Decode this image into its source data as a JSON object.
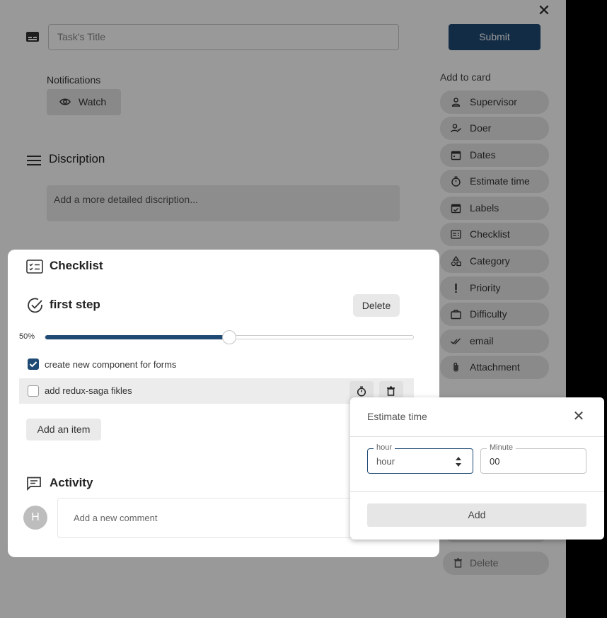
{
  "header": {
    "title_placeholder": "Task's Title",
    "submit_label": "Submit"
  },
  "notifications": {
    "label": "Notifications",
    "watch_label": "Watch"
  },
  "description": {
    "title": "Discription",
    "placeholder": "Add a more detailed discription..."
  },
  "sidebar": {
    "label": "Add to card",
    "items": [
      {
        "label": "Supervisor",
        "icon": "person-icon"
      },
      {
        "label": "Doer",
        "icon": "person-check-icon"
      },
      {
        "label": "Dates",
        "icon": "calendar-icon"
      },
      {
        "label": "Estimate time",
        "icon": "timer-icon"
      },
      {
        "label": "Labels",
        "icon": "calendar-check-icon"
      },
      {
        "label": "Checklist",
        "icon": "checklist-icon"
      },
      {
        "label": "Category",
        "icon": "category-icon"
      },
      {
        "label": "Priority",
        "icon": "exclamation-icon"
      },
      {
        "label": "Difficulty",
        "icon": "briefcase-icon"
      },
      {
        "label": "email",
        "icon": "double-check-icon"
      },
      {
        "label": "Attachment",
        "icon": "paperclip-icon"
      }
    ],
    "delete_label": "Delete"
  },
  "checklist": {
    "title": "Checklist",
    "step_title": "first step",
    "delete_label": "Delete",
    "progress_text": "50%",
    "progress_value": 0.5,
    "items": [
      {
        "label": "create new component for forms",
        "checked": true
      },
      {
        "label": "add redux-saga fikles",
        "checked": false
      }
    ],
    "add_item_label": "Add an item"
  },
  "activity": {
    "title": "Activity",
    "avatar_initial": "H",
    "comment_placeholder": "Add a new comment"
  },
  "estimate_popup": {
    "title": "Estimate time",
    "hour_legend": "hour",
    "hour_value": "hour",
    "minute_legend": "Minute",
    "minute_value": "00",
    "add_label": "Add"
  },
  "colors": {
    "primary": "#1e4a74"
  }
}
